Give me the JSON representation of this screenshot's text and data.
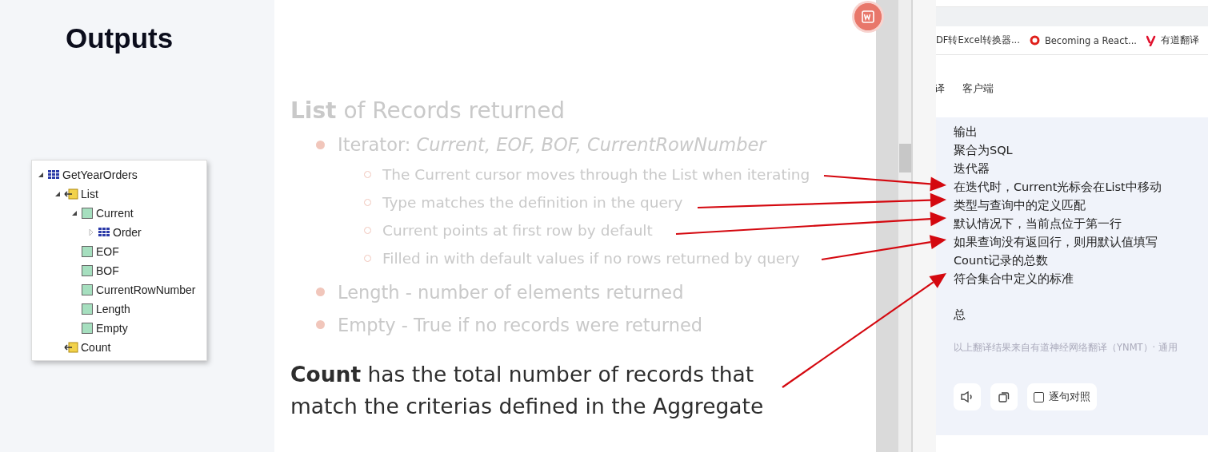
{
  "slide": {
    "title": "Outputs",
    "tree": [
      {
        "label": "GetYearOrders",
        "kind": "table",
        "expanded": true,
        "children": [
          {
            "label": "List",
            "kind": "output",
            "expanded": true,
            "children": [
              {
                "label": "Current",
                "kind": "attribute",
                "expanded": true,
                "children": [
                  {
                    "label": "Order",
                    "kind": "table",
                    "expanded": false
                  }
                ]
              },
              {
                "label": "EOF",
                "kind": "attribute"
              },
              {
                "label": "BOF",
                "kind": "attribute"
              },
              {
                "label": "CurrentRowNumber",
                "kind": "attribute"
              },
              {
                "label": "Length",
                "kind": "attribute"
              },
              {
                "label": "Empty",
                "kind": "attribute"
              }
            ]
          },
          {
            "label": "Count",
            "kind": "output"
          }
        ]
      }
    ],
    "heading": "**List** of Records returned",
    "bullets": [
      {
        "text": "Iterator: *Current, EOF, BOF, CurrentRowNumber*",
        "children": [
          "The Current cursor moves through the List when iterating",
          "Type matches the definition in the query",
          "Current points at first row by default",
          "Filled in with default values if no rows returned by query"
        ]
      },
      {
        "text": "Length - number of elements returned"
      },
      {
        "text": "Empty - True if no records were returned"
      }
    ],
    "footer": "**Count** has the total number of records that match the criterias defined in the Aggregate"
  },
  "browser": {
    "bookmarks": [
      {
        "label": "DF转Excel转换器...",
        "kind": "plain"
      },
      {
        "label": "Becoming a React...",
        "kind": "ring"
      },
      {
        "label": "有道翻译",
        "kind": "letter"
      }
    ],
    "tabs": [
      "译",
      "客户端"
    ],
    "translation": {
      "lines": [
        "输出",
        "聚合为SQL",
        "迭代器",
        "在迭代时，Current光标会在List中移动",
        "类型与查询中的定义匹配",
        "默认情况下，当前点位于第一行",
        "如果查询没有返回行，则用默认值填写",
        "Count记录的总数",
        "符合集合中定义的标准"
      ],
      "final_line": "总",
      "notice": "以上翻译结果来自有道神经网络翻译（YNMT）· 通用",
      "compare": {
        "label": "逐句对照",
        "checked": false
      }
    }
  }
}
